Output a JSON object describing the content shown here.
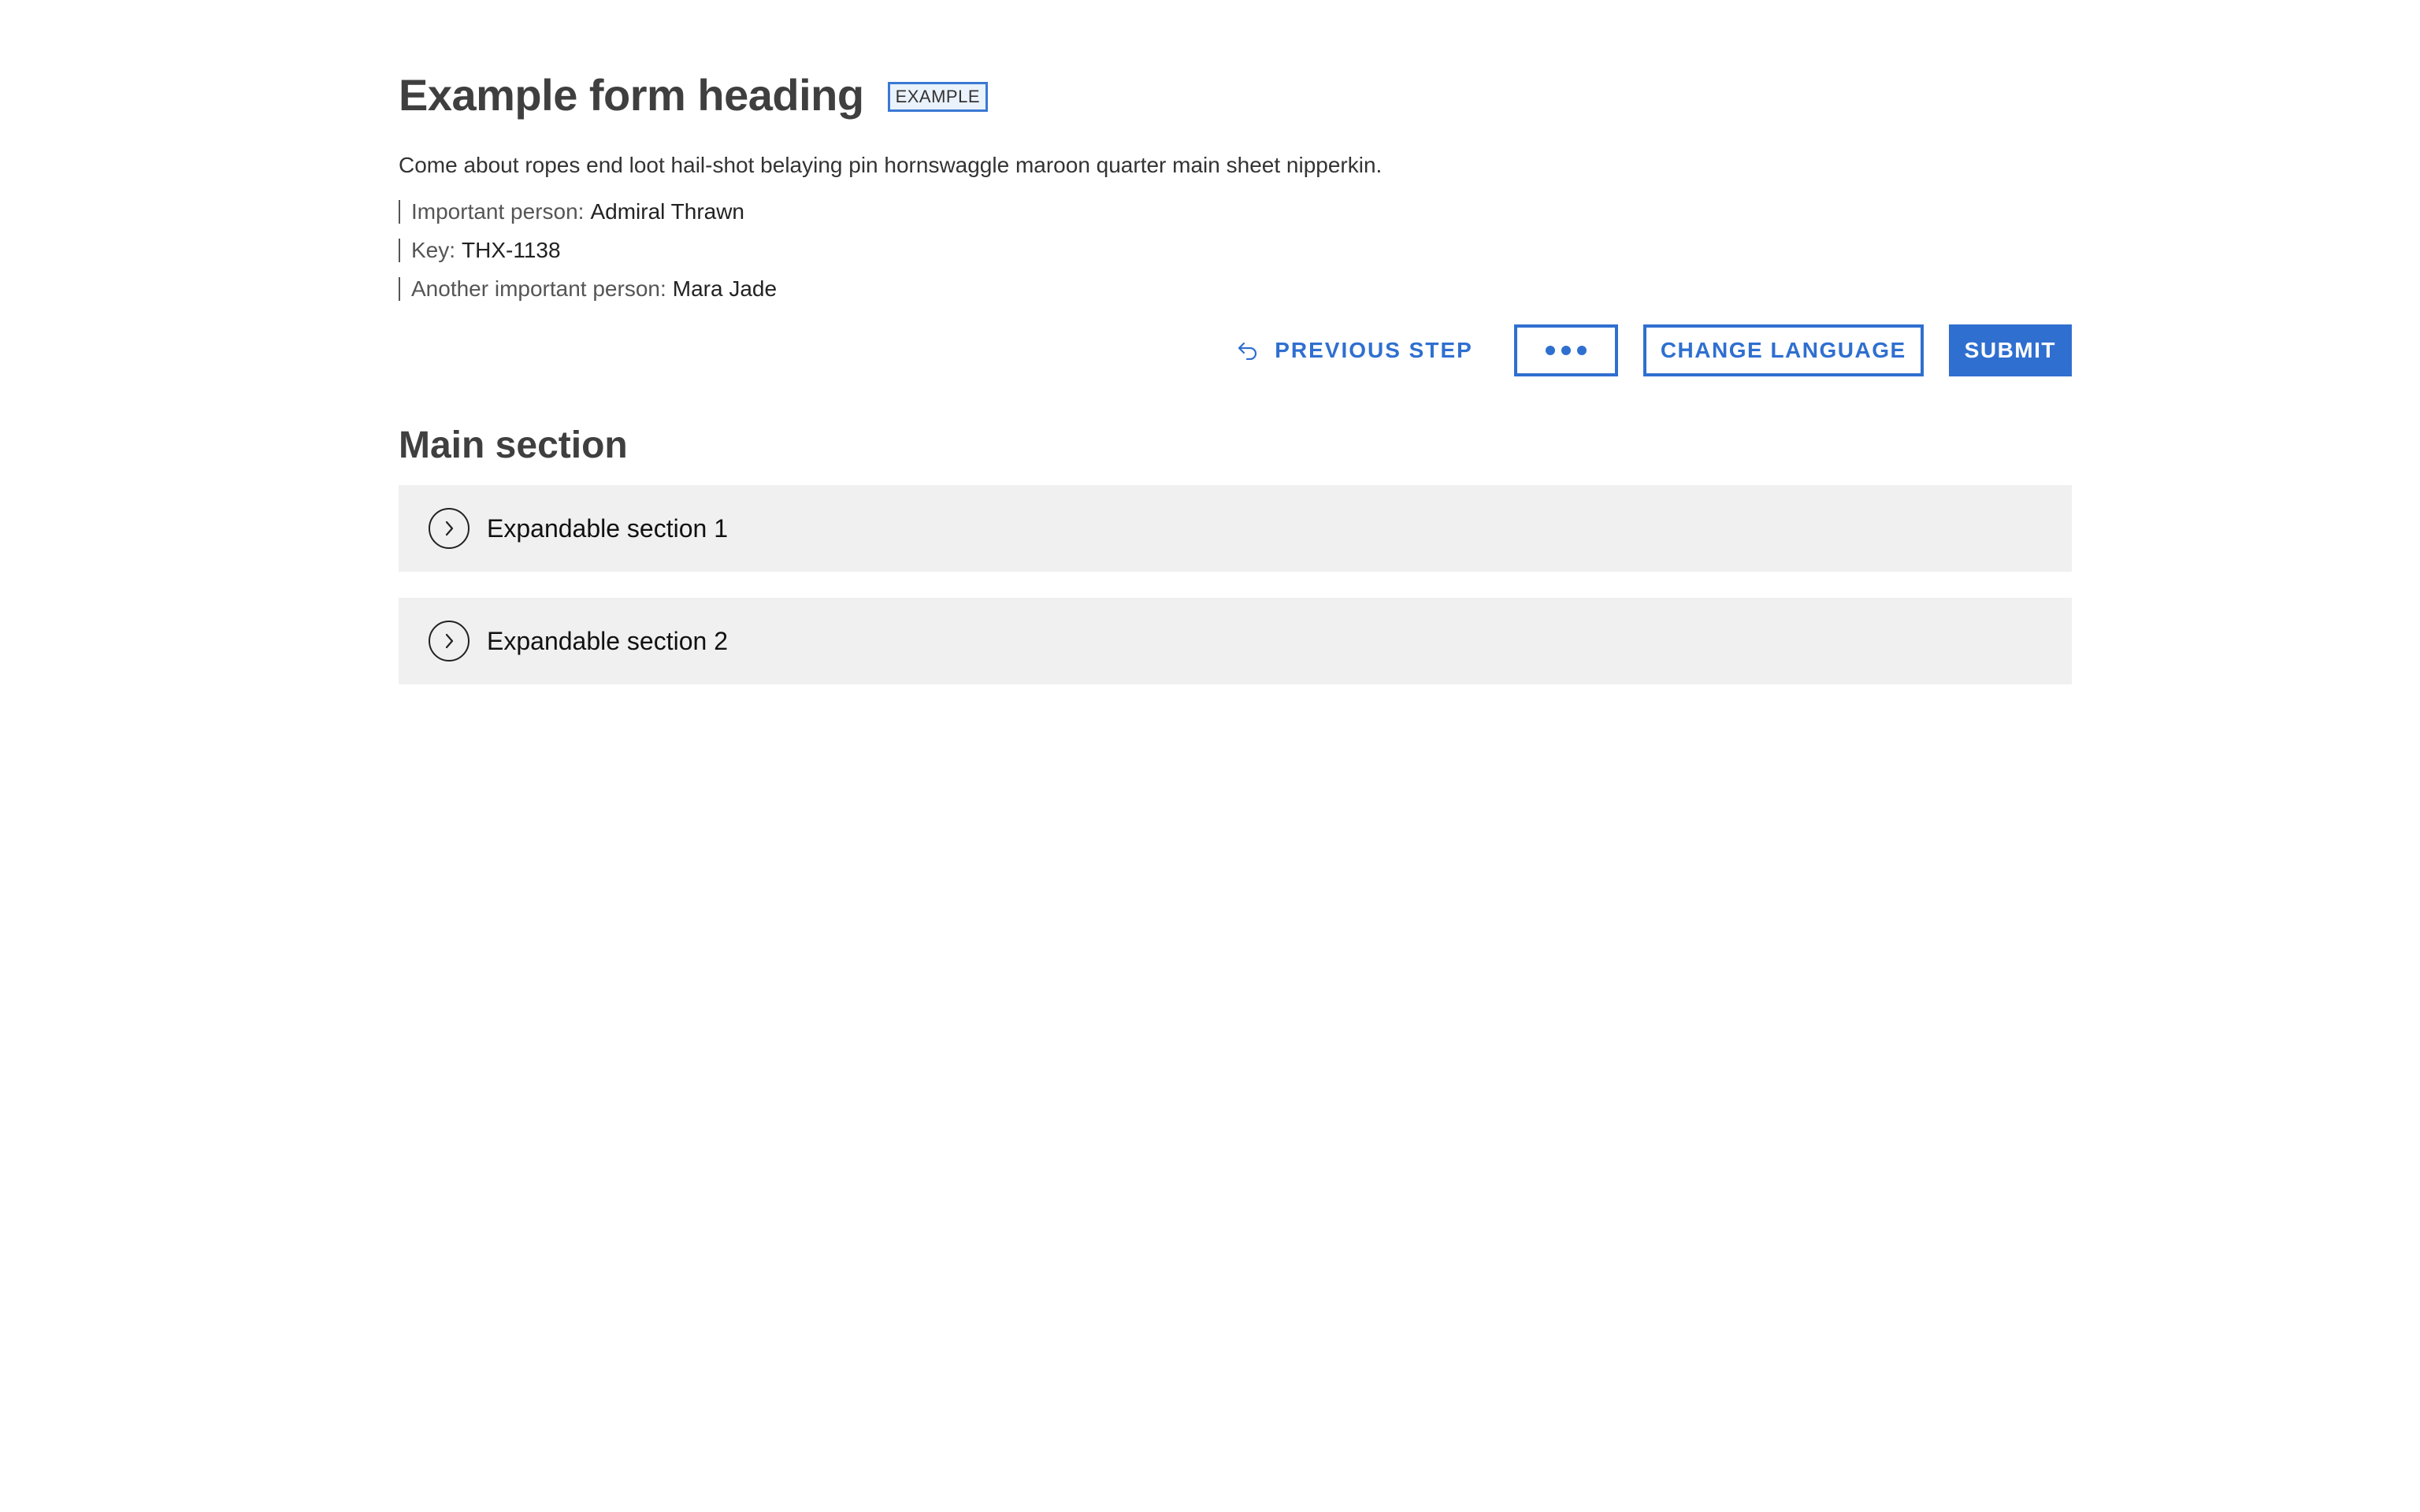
{
  "form": {
    "heading": "Example form heading",
    "badge": "EXAMPLE",
    "description": "Come about ropes end loot hail-shot belaying pin hornswaggle maroon quarter main sheet nipperkin.",
    "meta": [
      {
        "label": "Important person:",
        "value": "Admiral Thrawn"
      },
      {
        "label": "Key:",
        "value": "THX-1138"
      },
      {
        "label": "Another important person:",
        "value": "Mara Jade"
      }
    ]
  },
  "actions": {
    "previous_label": "PREVIOUS STEP",
    "more_icon": "more-dots-icon",
    "change_language_label": "CHANGE LANGUAGE",
    "submit_label": "SUBMIT",
    "accent_color": "#2f6fd0"
  },
  "main": {
    "title": "Main section",
    "sections": [
      {
        "label": "Expandable section 1",
        "icon": "chevron-right-icon"
      },
      {
        "label": "Expandable section 2",
        "icon": "chevron-right-icon"
      }
    ]
  }
}
